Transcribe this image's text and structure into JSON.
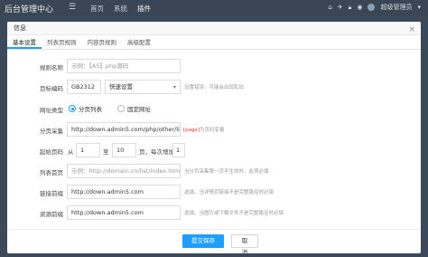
{
  "nav": {
    "brand": "后台管理中心",
    "menu_toggle_icon": "menu-icon",
    "items": [
      {
        "label": "首页",
        "active": false
      },
      {
        "label": "系统",
        "active": false
      },
      {
        "label": "插件",
        "active": true
      }
    ],
    "admin_label": "超级管理员"
  },
  "modal": {
    "title": "信息",
    "close_symbol": "×",
    "tabs": [
      {
        "label": "基本设置",
        "active": true
      },
      {
        "label": "列表页规则",
        "active": false
      },
      {
        "label": "内容页规则",
        "active": false
      },
      {
        "label": "高级配置",
        "active": false
      }
    ],
    "fields": {
      "rule_name": {
        "label": "规则名称",
        "placeholder": "示例：【A5】php源码"
      },
      "encoding": {
        "label": "目标编码",
        "value": "GB2312",
        "select_value": "快速设置",
        "hint": "设置错误，可能会出现乱码"
      },
      "url_type": {
        "label": "网址类型",
        "options": [
          "分页列表",
          "固定网址"
        ],
        "selected": "分页列表"
      },
      "page_collect": {
        "label": "分页采集",
        "value": "http://down.admin5.com/php/other/list_58_[pa",
        "hint_red": "[page]",
        "hint_rest": "为页码变量"
      },
      "start_page": {
        "label": "起始页码",
        "prefix": "从",
        "from": "1",
        "to_label": "至",
        "to": "10",
        "step_label": "页，每次增加",
        "step": "1"
      },
      "list_page": {
        "label": "列表首页",
        "placeholder": "示例：http://domain.cn/list/index.html",
        "hint": "当分页采集第一页不生效时，此项必填"
      },
      "link_prefix": {
        "label": "链接前缀",
        "value": "http://down.admin5.com",
        "hint": "选填。当详情页链接不是完整路径时必填"
      },
      "resource_prefix": {
        "label": "资源前缀",
        "value": "http://down.admin5.com",
        "hint": "选填。当图片或下载文件不是完整路径时必填"
      }
    },
    "buttons": {
      "submit": "提交保存",
      "cancel": "取消"
    }
  },
  "colors": {
    "accent": "#1e9fff",
    "topbar": "#3a4654",
    "danger": "#ee3333"
  }
}
